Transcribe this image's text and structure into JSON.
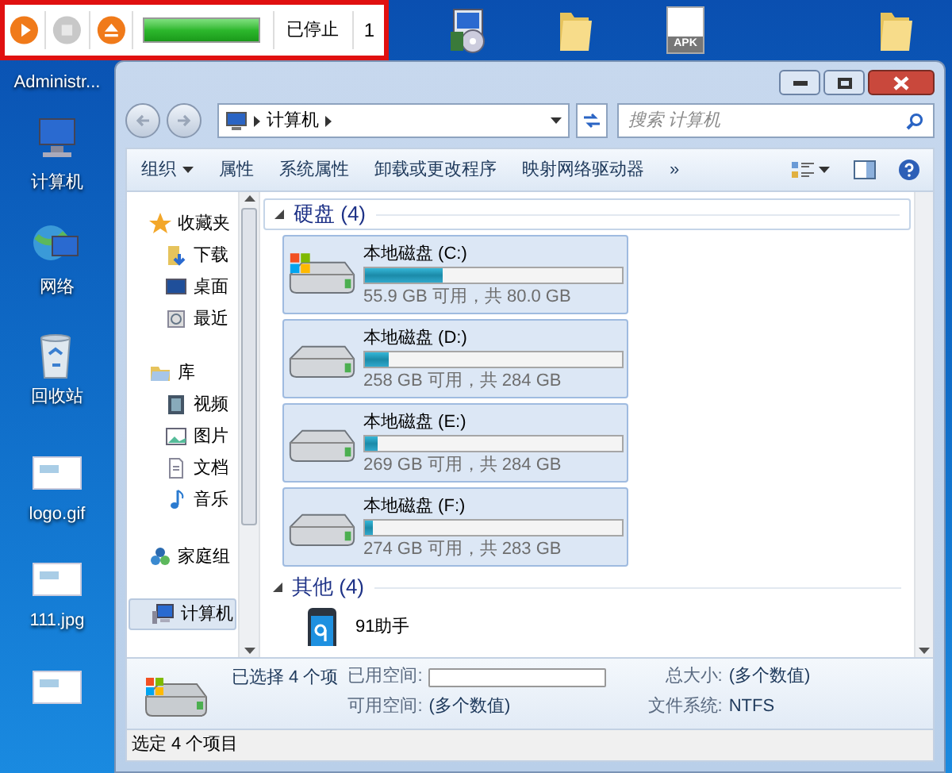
{
  "player": {
    "buttons": [
      {
        "kind": "play",
        "disabled": false
      },
      {
        "kind": "stop",
        "disabled": true
      },
      {
        "kind": "eject",
        "disabled": false
      }
    ],
    "level": 1,
    "status": "已停止",
    "count": "1"
  },
  "desktop_top": [
    {
      "kind": "setup"
    },
    {
      "kind": "folder"
    },
    {
      "kind": "apk",
      "label": "APK"
    },
    {
      "kind": "folder"
    }
  ],
  "desktop_left": [
    {
      "kind": "none",
      "label": "Administr..."
    },
    {
      "kind": "computer",
      "label": "计算机"
    },
    {
      "kind": "network",
      "label": "网络"
    },
    {
      "kind": "recycle",
      "label": "回收站"
    },
    {
      "kind": "image",
      "label": "logo.gif"
    },
    {
      "kind": "image",
      "label": "111.jpg"
    },
    {
      "kind": "image"
    }
  ],
  "address": {
    "path": "计算机",
    "search_placeholder": "搜索 计算机"
  },
  "commands": [
    {
      "label": "组织",
      "dropdown": true
    },
    {
      "label": "属性",
      "dropdown": false
    },
    {
      "label": "系统属性",
      "dropdown": false
    },
    {
      "label": "卸载或更改程序",
      "dropdown": false
    },
    {
      "label": "映射网络驱动器",
      "dropdown": false
    },
    {
      "label": "»",
      "dropdown": false
    }
  ],
  "nav": [
    {
      "kind": "favorites",
      "label": "收藏夹",
      "children": [
        {
          "kind": "download",
          "label": "下载",
          "selected": false
        },
        {
          "kind": "desktop",
          "label": "桌面",
          "selected": false
        },
        {
          "kind": "recent",
          "label": "最近",
          "selected": false
        }
      ],
      "selected": false
    },
    {
      "kind": "library",
      "label": "库",
      "children": [
        {
          "kind": "video",
          "label": "视频",
          "selected": false
        },
        {
          "kind": "picture",
          "label": "图片",
          "selected": false
        },
        {
          "kind": "document",
          "label": "文档",
          "selected": false
        },
        {
          "kind": "music",
          "label": "音乐",
          "selected": false
        }
      ],
      "selected": false
    },
    {
      "kind": "homegroup",
      "label": "家庭组",
      "selected": false
    },
    {
      "kind": "computer",
      "label": "计算机",
      "selected": true
    }
  ],
  "groups": [
    {
      "title": "硬盘 (4)",
      "expanded": true,
      "items": [
        {
          "kind": "drive",
          "system": true,
          "name": "本地磁盘 (C:)",
          "level": 0.3,
          "info": "55.9 GB 可用，共 80.0 GB",
          "selected": true
        },
        {
          "kind": "drive",
          "system": false,
          "name": "本地磁盘 (D:)",
          "level": 0.09,
          "info": "258 GB 可用，共 284 GB",
          "selected": true
        },
        {
          "kind": "drive",
          "system": false,
          "name": "本地磁盘 (E:)",
          "level": 0.05,
          "info": "269 GB 可用，共 284 GB",
          "selected": true
        },
        {
          "kind": "drive",
          "system": false,
          "name": "本地磁盘 (F:)",
          "level": 0.03,
          "info": "274 GB 可用，共 283 GB",
          "selected": true
        }
      ]
    },
    {
      "title": "其他 (4)",
      "expanded": true,
      "items": [
        {
          "kind": "device",
          "name": "91助手",
          "selected": false
        }
      ]
    }
  ],
  "details": {
    "summary": "已选择 4 个项",
    "fields": [
      {
        "kind": "bar",
        "label": "已用空间:"
      },
      {
        "kind": "text",
        "label": "总大小:",
        "value": "(多个数值)"
      },
      {
        "kind": "text",
        "label": "可用空间:",
        "value": "(多个数值)"
      },
      {
        "kind": "text",
        "label": "文件系统:",
        "value": "NTFS"
      }
    ]
  },
  "status_bar": "选定 4 个项目"
}
